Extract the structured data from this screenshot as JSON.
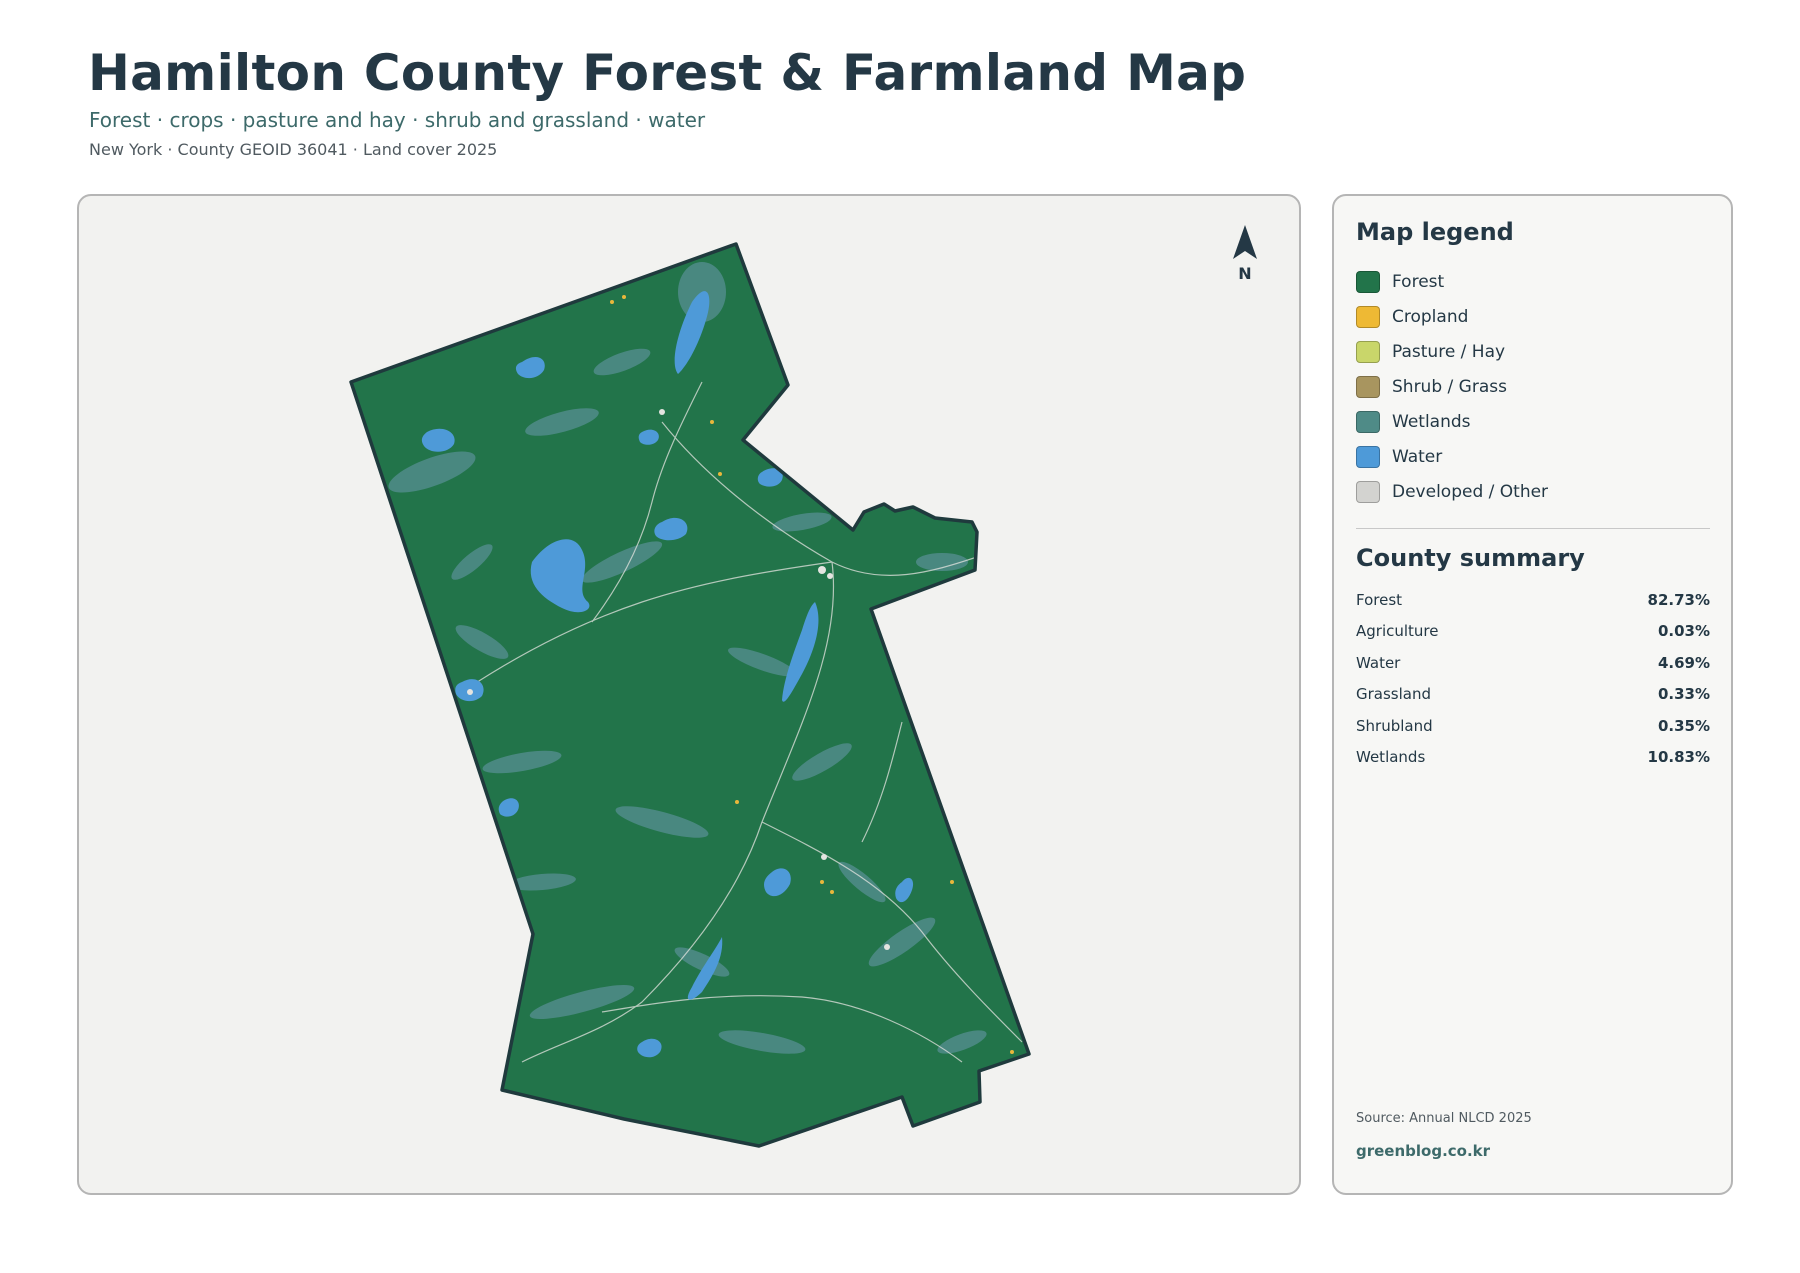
{
  "header": {
    "title": "Hamilton County Forest & Farmland Map",
    "subtitle": "Forest · crops · pasture and hay · shrub and grassland · water",
    "meta": "New York · County GEOID 36041 · Land cover 2025"
  },
  "map": {
    "north_label": "N",
    "colors": {
      "forest": "#22744a",
      "water": "#4e9ad8",
      "wetlands": "#4f8b87",
      "shrub": "#a8955f",
      "cropland": "#e9b73b",
      "developed": "#e4e4e0",
      "outline": "#1f3a3d"
    }
  },
  "legend": {
    "title": "Map legend",
    "items": [
      {
        "label": "Forest",
        "color": "#22744a"
      },
      {
        "label": "Cropland",
        "color": "#eeb934"
      },
      {
        "label": "Pasture / Hay",
        "color": "#c9d66a"
      },
      {
        "label": "Shrub / Grass",
        "color": "#a8955f"
      },
      {
        "label": "Wetlands",
        "color": "#4f8b87"
      },
      {
        "label": "Water",
        "color": "#4e9ad8"
      },
      {
        "label": "Developed / Other",
        "color": "#d3d3d0"
      }
    ]
  },
  "summary": {
    "title": "County summary",
    "rows": [
      {
        "name": "Forest",
        "value": "82.73%"
      },
      {
        "name": "Agriculture",
        "value": "0.03%"
      },
      {
        "name": "Water",
        "value": "4.69%"
      },
      {
        "name": "Grassland",
        "value": "0.33%"
      },
      {
        "name": "Shrubland",
        "value": "0.35%"
      },
      {
        "name": "Wetlands",
        "value": "10.83%"
      }
    ]
  },
  "footer": {
    "source": "Source: Annual NLCD 2025",
    "brand": "greenblog.co.kr"
  }
}
